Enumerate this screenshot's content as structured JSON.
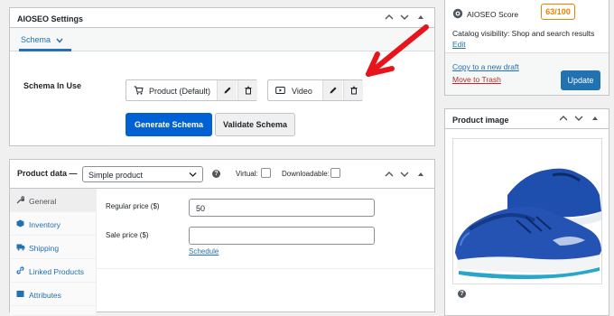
{
  "aioseo_box": {
    "title": "AIOSEO Settings",
    "tab": "Schema",
    "schema_label": "Schema In Use",
    "items": [
      {
        "label": "Product (Default)"
      },
      {
        "label": "Video"
      }
    ],
    "generate_button": "Generate Schema",
    "validate_button": "Validate Schema"
  },
  "product_data": {
    "title": "Product data —",
    "type_selected": "Simple product",
    "virtual_label": "Virtual:",
    "downloadable_label": "Downloadable:",
    "nav": [
      {
        "label": "General",
        "icon": "wrench-icon"
      },
      {
        "label": "Inventory",
        "icon": "inventory-icon"
      },
      {
        "label": "Shipping",
        "icon": "truck-icon"
      },
      {
        "label": "Linked Products",
        "icon": "link-icon"
      },
      {
        "label": "Attributes",
        "icon": "list-icon"
      }
    ],
    "regular_price_label": "Regular price ($)",
    "regular_price_value": "50",
    "sale_price_label": "Sale price ($)",
    "sale_price_value": "",
    "schedule_link": "Schedule"
  },
  "publish_box": {
    "score_label": "AIOSEO Score",
    "score_value": "63/100",
    "catalog_text": "Catalog visibility: Shop and search results",
    "edit_link": "Edit",
    "copy_link": "Copy to a new draft",
    "trash_link": "Move to Trash",
    "update_button": "Update"
  },
  "product_image_box": {
    "title": "Product image"
  },
  "colors": {
    "primary": "#0061d5",
    "wp_blue": "#2271b1",
    "score_orange": "#f18200",
    "arrow_red": "#e8141b",
    "trash_red": "#b32d2e"
  }
}
